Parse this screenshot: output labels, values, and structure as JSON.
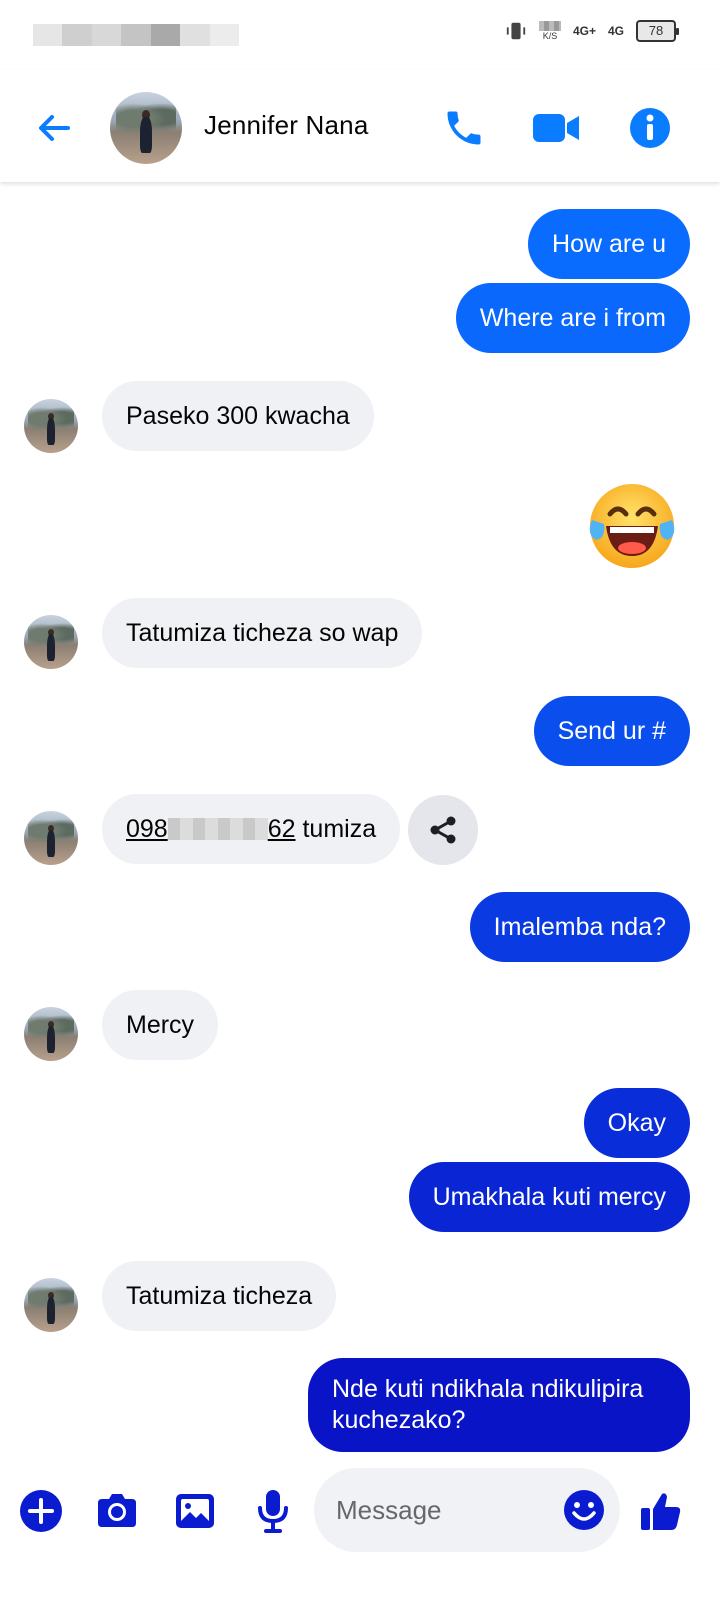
{
  "status_bar": {
    "battery": "78",
    "speed_unit": "K/S",
    "net1": "4G+",
    "net2": "4G"
  },
  "header": {
    "contact_name": "Jennifer Nana",
    "icons": [
      "back-arrow-icon",
      "phone-icon",
      "video-camera-icon",
      "info-icon"
    ]
  },
  "colors": {
    "accent": "#0a7cff",
    "bubble_blue_light": "#0a6cff",
    "bubble_blue_dark": "#0a14c7",
    "incoming_bubble": "#f0f1f5"
  },
  "messages": [
    {
      "dir": "out",
      "text": "How are u"
    },
    {
      "dir": "out",
      "text": "Where are i from"
    },
    {
      "dir": "in",
      "text": "Paseko 300 kwacha"
    },
    {
      "dir": "out",
      "emoji": "face-with-tears-of-joy"
    },
    {
      "dir": "in",
      "text": "Tatumiza ticheza so wap"
    },
    {
      "dir": "out",
      "text": "Send ur #"
    },
    {
      "dir": "in",
      "phone_start": "098",
      "phone_end": "62",
      "text_after": " tumiza"
    },
    {
      "dir": "out",
      "text": "Imalemba nda?"
    },
    {
      "dir": "in",
      "text": "Mercy"
    },
    {
      "dir": "out",
      "text": "Okay"
    },
    {
      "dir": "out",
      "text": "Umakhala kuti mercy"
    },
    {
      "dir": "in",
      "text": "Tatumiza ticheza"
    },
    {
      "dir": "out",
      "text_line1": "Nde kuti ndikhala ndikulipira",
      "text_line2": "kuchezako?"
    }
  ],
  "composer": {
    "placeholder": "Message",
    "icons": [
      "plus-icon",
      "camera-icon",
      "gallery-icon",
      "microphone-icon",
      "emoji-icon",
      "thumbs-up-icon"
    ]
  }
}
